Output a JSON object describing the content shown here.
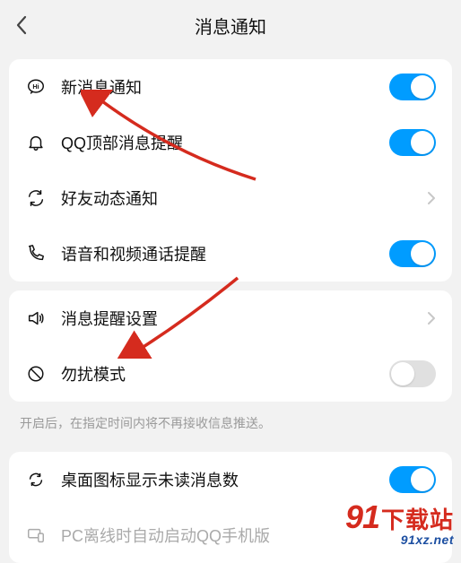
{
  "header": {
    "title": "消息通知"
  },
  "group1": {
    "items": [
      {
        "label": "新消息通知",
        "right": "switch",
        "on": true,
        "icon": "hi"
      },
      {
        "label": "QQ顶部消息提醒",
        "right": "switch",
        "on": true,
        "icon": "bell"
      },
      {
        "label": "好友动态通知",
        "right": "chevron",
        "icon": "refresh"
      },
      {
        "label": "语音和视频通话提醒",
        "right": "switch",
        "on": true,
        "icon": "phone"
      }
    ]
  },
  "group2": {
    "items": [
      {
        "label": "消息提醒设置",
        "right": "chevron",
        "icon": "speaker"
      },
      {
        "label": "勿扰模式",
        "right": "switch",
        "on": false,
        "icon": "ban"
      }
    ],
    "helper": "开启后，在指定时间内将不再接收信息推送。"
  },
  "group3": {
    "items": [
      {
        "label": "桌面图标显示未读消息数",
        "right": "switch",
        "on": true,
        "icon": "desktop-refresh"
      },
      {
        "label": "PC离线时自动启动QQ手机版",
        "right": "none",
        "disabled": true,
        "icon": "devices"
      }
    ]
  },
  "watermark": {
    "brand_num": "91",
    "brand_cn": "下载站",
    "url": "91xz.net"
  },
  "colors": {
    "accent": "#009cff",
    "arrow": "#d52b1e"
  }
}
